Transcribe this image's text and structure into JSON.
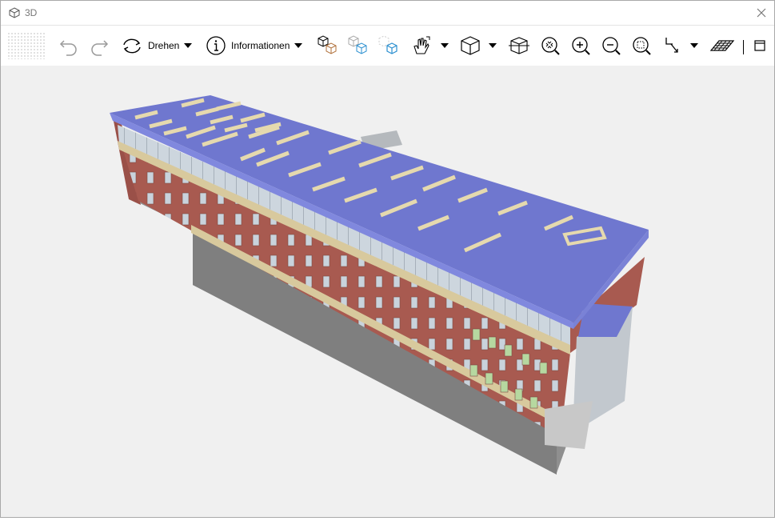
{
  "window": {
    "title": "3D",
    "title_icon": "cube-icon",
    "close_icon": "close-icon"
  },
  "toolbar": {
    "undo_icon": "undo-icon",
    "redo_icon": "redo-icon",
    "rotate_label": "Drehen",
    "rotate_icon": "rotate-icon",
    "info_label": "Informationen",
    "info_icon": "info-icon",
    "tools": [
      "multi-cube-icon",
      "ghost-cubes-icon",
      "blue-cube-icon",
      "hand-tool-icon",
      "view-cube-icon",
      "section-box-icon",
      "zoom-fit-icon",
      "zoom-in-icon",
      "zoom-out-icon",
      "zoom-window-icon",
      "pointer-icon",
      "grid-plane-icon",
      "window-toggle-icon"
    ]
  },
  "colors": {
    "roof": "#6f77cf",
    "roof_edge": "#7f86dd",
    "brick": "#a85a50",
    "glass": "#c9d3dc",
    "band": "#d8c99d",
    "base": "#8c8c8c",
    "window_green": "#b6d8a0"
  }
}
